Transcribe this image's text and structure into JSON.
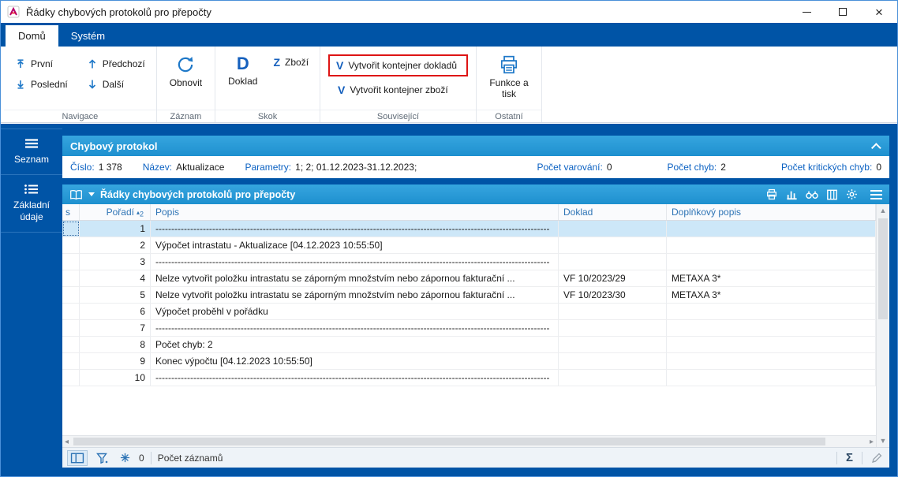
{
  "window": {
    "title": "Řádky chybových protokolů pro přepočty"
  },
  "tabs": {
    "home": "Domů",
    "system": "Systém"
  },
  "ribbon": {
    "first": "První",
    "last": "Poslední",
    "previous": "Předchozí",
    "next": "Další",
    "refresh": "Obnovit",
    "document": "Doklad",
    "document_letter": "D",
    "goods": "Zboží",
    "goods_letter": "Z",
    "container_letter": "V",
    "create_container_documents": "Vytvořit kontejner dokladů",
    "create_container_goods": "Vytvořit kontejner zboží",
    "functions_print": "Funkce a tisk",
    "groups": {
      "navigation": "Navigace",
      "record": "Záznam",
      "jump": "Skok",
      "related": "Související",
      "other": "Ostatní"
    }
  },
  "sidebar": {
    "list": "Seznam",
    "basic_data": "Základní údaje"
  },
  "protocol": {
    "title": "Chybový protokol",
    "fields": [
      {
        "label": "Číslo:",
        "value": "1 378"
      },
      {
        "label": "Název:",
        "value": "Aktualizace"
      },
      {
        "label": "Parametry:",
        "value": "1; 2; 01.12.2023-31.12.2023;"
      },
      {
        "label": "Počet varování:",
        "value": "0"
      },
      {
        "label": "Počet chyb:",
        "value": "2"
      },
      {
        "label": "Počet kritických chyb:",
        "value": "0"
      }
    ]
  },
  "grid": {
    "title": "Řádky chybových protokolů pro přepočty",
    "columns": {
      "s": "s",
      "order": "Pořadí",
      "description": "Popis",
      "document": "Doklad",
      "additional": "Doplňkový popis"
    },
    "sort_number": "2",
    "rows": [
      {
        "order": "1",
        "description": "-----------------------------------------------------------------------------------------------------------------------------",
        "document": "",
        "additional": "",
        "selected": true
      },
      {
        "order": "2",
        "description": "Výpočet intrastatu - Aktualizace [04.12.2023 10:55:50]",
        "document": "",
        "additional": ""
      },
      {
        "order": "3",
        "description": "-----------------------------------------------------------------------------------------------------------------------------",
        "document": "",
        "additional": ""
      },
      {
        "order": "4",
        "description": "Nelze vytvořit položku intrastatu se záporným množstvím nebo zápornou fakturační ...",
        "document": "VF 10/2023/29",
        "additional": "METAXA 3*"
      },
      {
        "order": "5",
        "description": "Nelze vytvořit položku intrastatu se záporným množstvím nebo zápornou fakturační ...",
        "document": "VF 10/2023/30",
        "additional": "METAXA 3*"
      },
      {
        "order": "6",
        "description": "Výpočet proběhl v pořádku",
        "document": "",
        "additional": ""
      },
      {
        "order": "7",
        "description": "-----------------------------------------------------------------------------------------------------------------------------",
        "document": "",
        "additional": ""
      },
      {
        "order": "8",
        "description": "Počet chyb: 2",
        "document": "",
        "additional": ""
      },
      {
        "order": "9",
        "description": "Konec výpočtu [04.12.2023 10:55:50]",
        "document": "",
        "additional": ""
      },
      {
        "order": "10",
        "description": "-----------------------------------------------------------------------------------------------------------------------------",
        "document": "",
        "additional": ""
      }
    ]
  },
  "statusbar": {
    "frozen_count": "0",
    "records": "Počet záznamů"
  }
}
